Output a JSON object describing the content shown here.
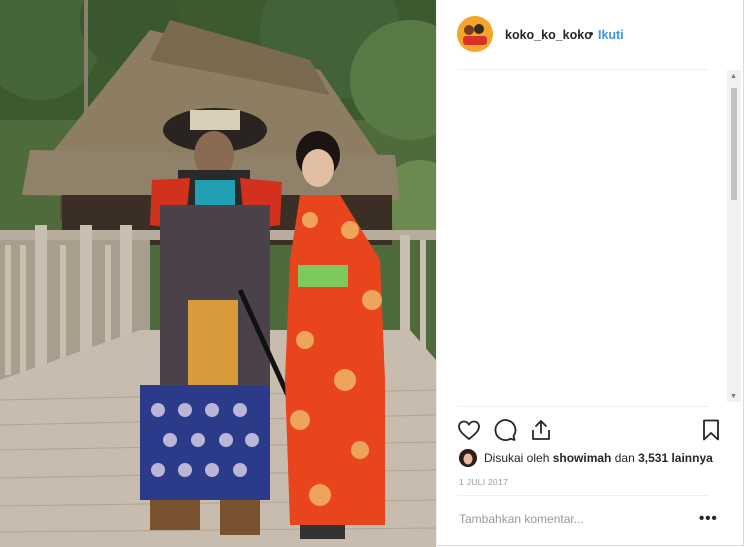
{
  "post": {
    "username": "koko_ko_koko",
    "separator": "•",
    "follow_label": "Ikuti",
    "likes_prefix": "Disukai oleh ",
    "liker_name": "showimah",
    "likes_connector": " dan ",
    "likes_count": "3,531 lainnya",
    "date": "1 JULI 2017",
    "comment_placeholder": "Tambahkan komentar...",
    "more_label": "•••"
  },
  "icons": {
    "like": "heart-icon",
    "comment": "comment-icon",
    "share": "share-icon",
    "save": "bookmark-icon",
    "more": "more-options-icon"
  },
  "colors": {
    "link": "#3897f0",
    "text": "#262626",
    "muted": "#999999",
    "divider": "#efefef"
  }
}
